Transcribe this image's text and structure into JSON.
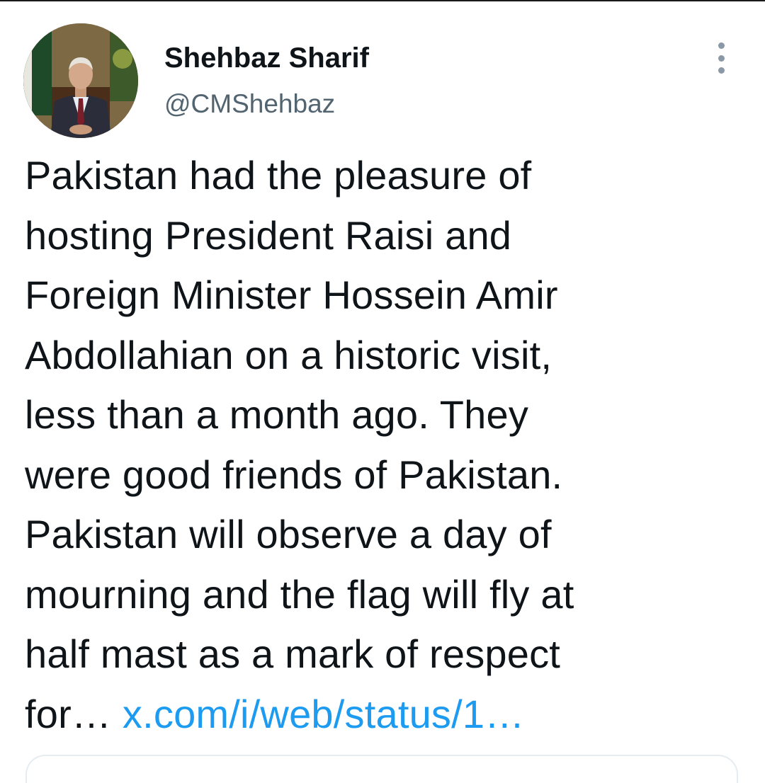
{
  "author": {
    "display_name": "Shehbaz Sharif",
    "handle": "@CMShehbaz",
    "avatar_icon": "profile-photo"
  },
  "tweet": {
    "lines": [
      "Pakistan had the pleasure of",
      "hosting President Raisi and",
      "Foreign Minister Hossein Amir",
      "Abdollahian on a historic visit,",
      "less than a month ago. They",
      "were good friends of Pakistan.",
      "Pakistan will observe a day of",
      "mourning and the flag will fly at",
      "half mast as a mark of respect"
    ],
    "last_line_text": "for… ",
    "link_text": "x.com/i/web/status/1…"
  },
  "menu": {
    "icon": "more-vertical-icon"
  },
  "colors": {
    "text": "#0f1419",
    "secondary_text": "#536471",
    "link": "#1d9bf0",
    "background": "#ffffff"
  }
}
